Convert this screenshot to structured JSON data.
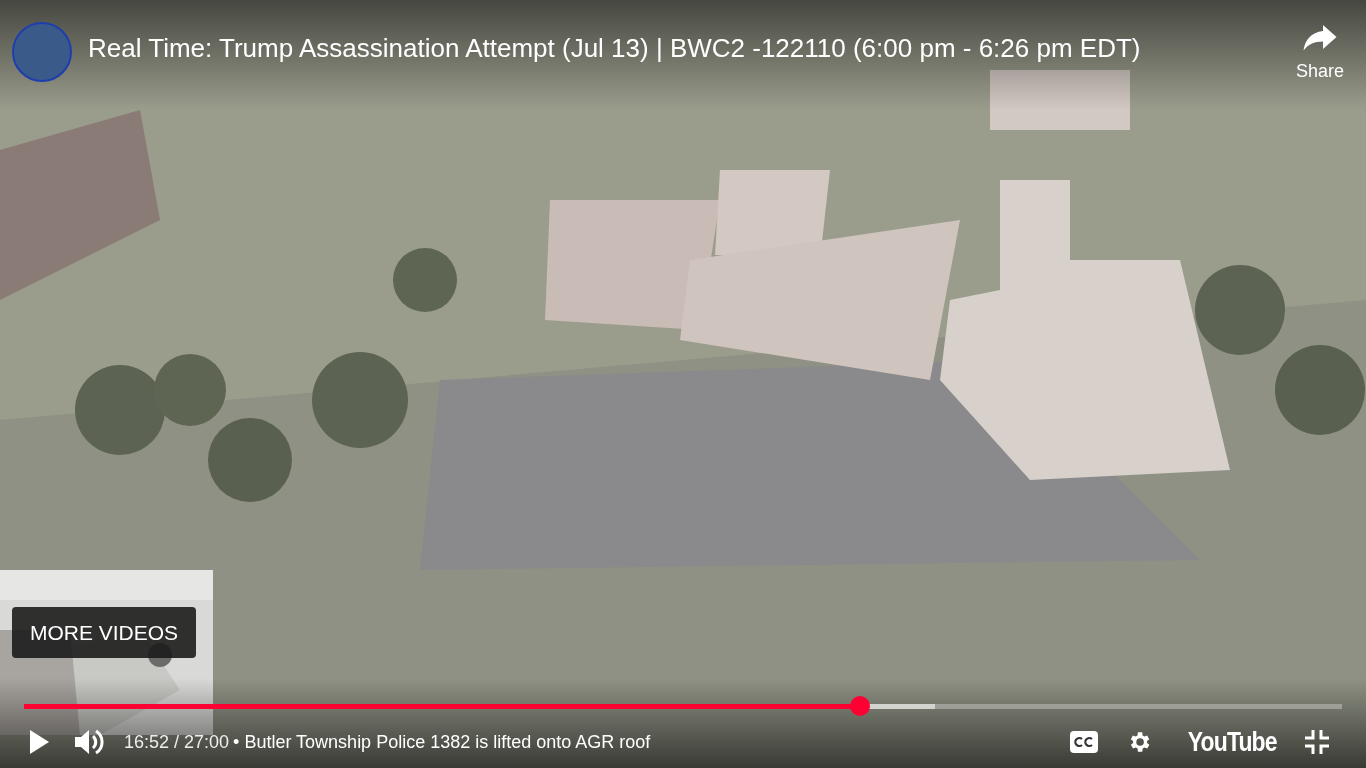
{
  "header": {
    "title": "Real Time: Trump Assassination Attempt (Jul 13) | BWC2 -122110 (6:00 pm - 6:26 pm EDT)",
    "share": "Share"
  },
  "more_videos": {
    "label": "MORE VIDEOS"
  },
  "progress": {
    "level": 0.634
  },
  "buffer": {
    "level": 0.691
  },
  "controls": {
    "time": "16:52 / 27:00",
    "chapter": "• Butler Township Police 1382 is lifted onto AGR roof",
    "logo": "YouTube"
  }
}
